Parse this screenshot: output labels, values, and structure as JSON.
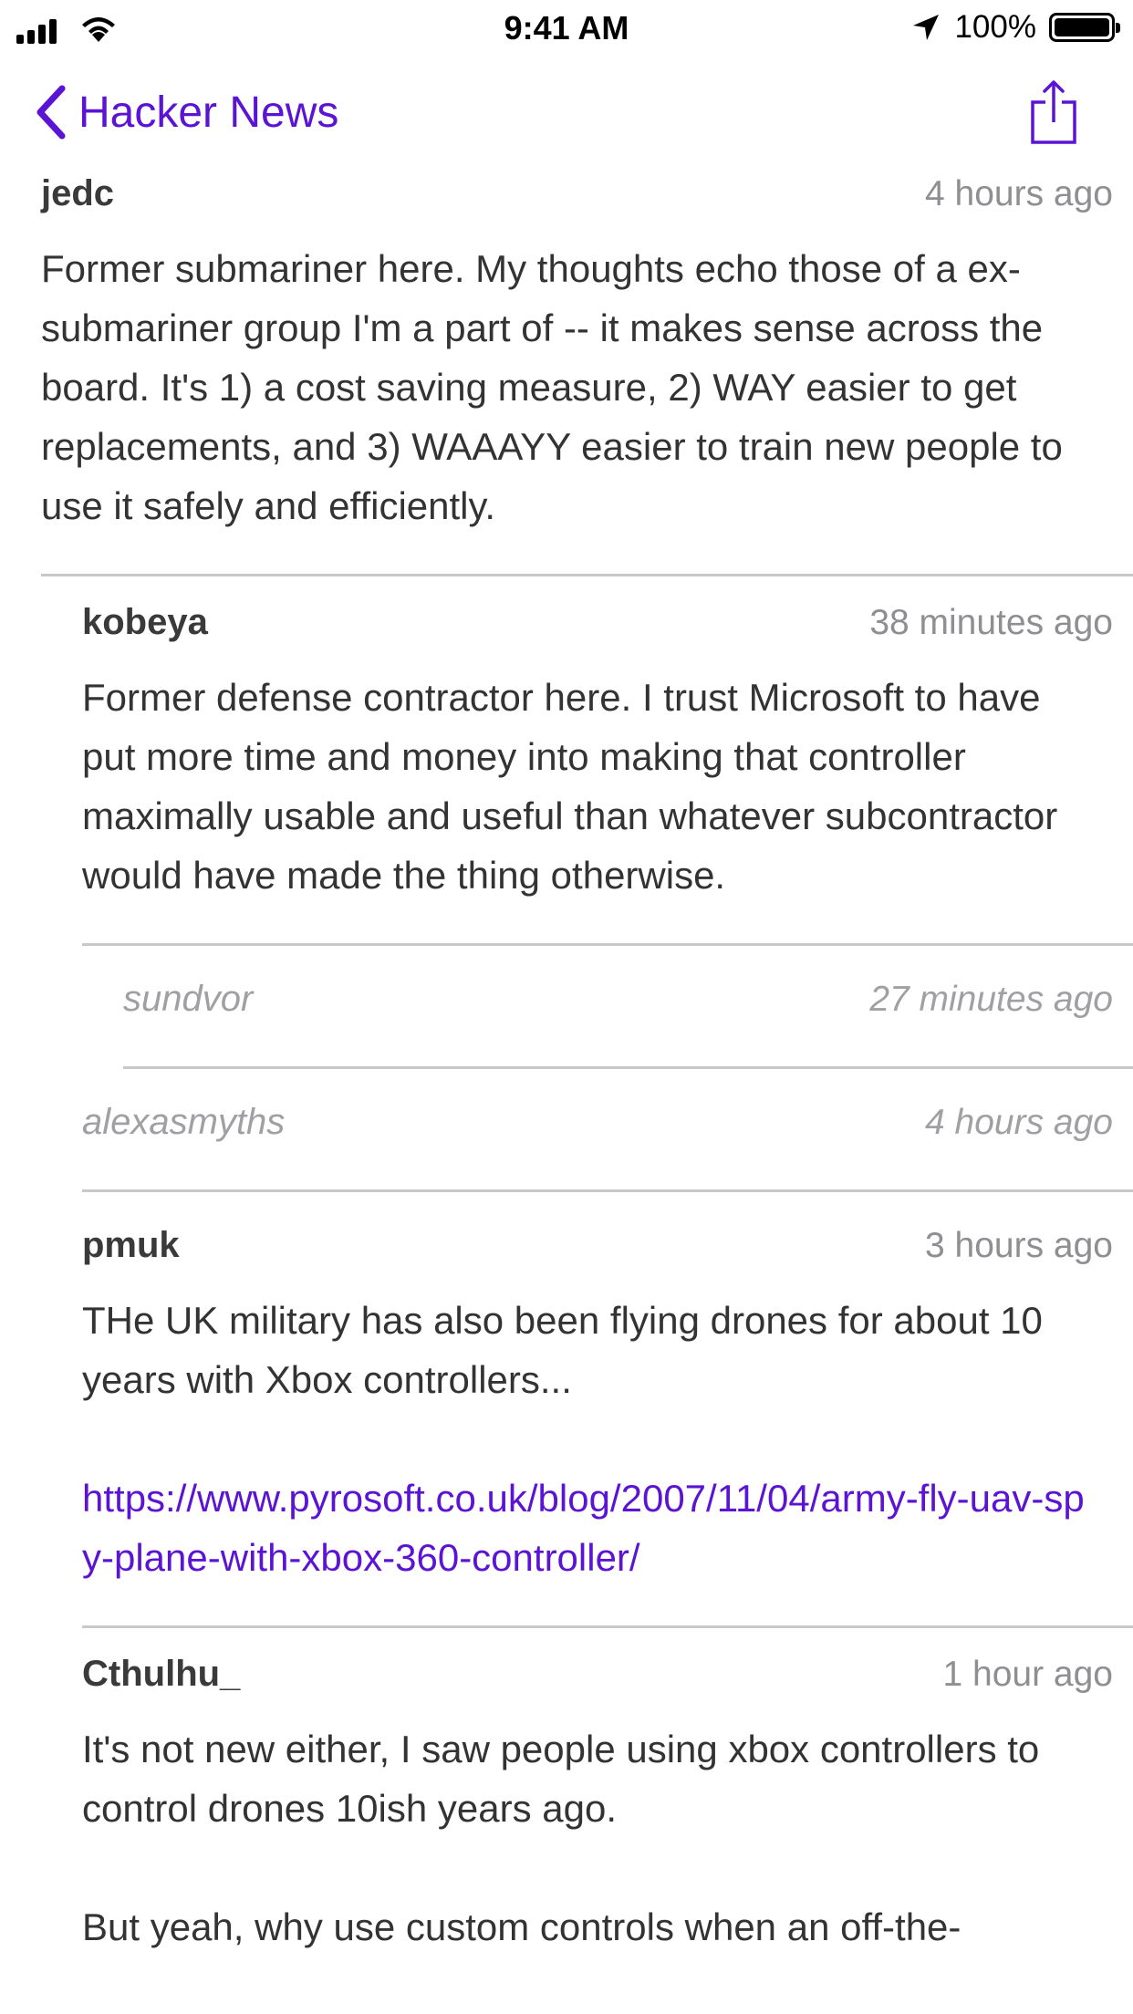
{
  "status_bar": {
    "time": "9:41 AM",
    "battery_percent": "100%",
    "battery_level": 1.0,
    "icons": [
      "cellular-signal-icon",
      "wifi-icon",
      "location-arrow-icon",
      "battery-icon"
    ]
  },
  "nav": {
    "back_label": "Hacker News",
    "accent_color": "#5b14d4",
    "icons": [
      "chevron-left-icon",
      "share-icon"
    ]
  },
  "comments": [
    {
      "author": "jedc",
      "time": "4 hours ago",
      "depth": 0,
      "paragraphs": [
        "Former submariner here.  My thoughts echo those of a ex-submariner group I'm a part of -- it makes sense across the board.  It's 1) a cost saving measure, 2) WAY easier to get replacements, and 3) WAAAYY easier to train new people to use it safely and efficiently."
      ]
    },
    {
      "author": "kobeya",
      "time": "38 minutes ago",
      "depth": 1,
      "paragraphs": [
        "Former defense contractor here. I trust Microsoft to have put more time and money into making that controller maximally usable and useful than whatever subcontractor would have made the thing otherwise."
      ]
    },
    {
      "author": "sundvor",
      "time": "27 minutes ago",
      "depth": 2,
      "collapsed": true
    },
    {
      "author": "alexasmyths",
      "time": "4 hours ago",
      "depth": 1,
      "collapsed": true
    },
    {
      "author": "pmuk",
      "time": "3 hours ago",
      "depth": 1,
      "paragraphs": [
        "THe UK military has also been flying drones for about 10 years with Xbox controllers..."
      ],
      "link": "https://www.pyrosoft.co.uk/blog/2007/11/04/army-fly-uav-spy-plane-with-xbox-360-controller/"
    },
    {
      "author": "Cthulhu_",
      "time": "1 hour ago",
      "depth": 1,
      "paragraphs": [
        "It's not new either, I saw people using xbox controllers to control drones 10ish years ago.",
        "But yeah, why use custom controls when an off-the-"
      ]
    }
  ]
}
